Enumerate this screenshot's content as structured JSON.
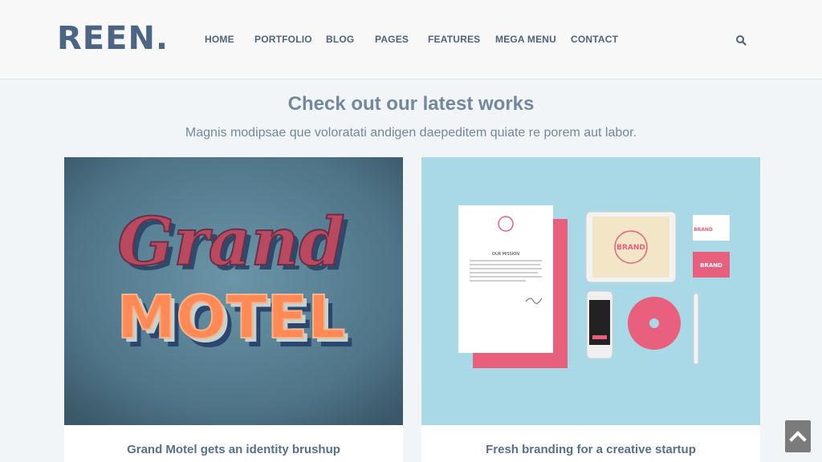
{
  "brand": {
    "logo": "REEN."
  },
  "nav": {
    "items": [
      "HOME",
      "PORTFOLIO",
      "BLOG",
      "PAGES",
      "FEATURES",
      "MEGA MENU",
      "CONTACT"
    ],
    "search_icon": "search-icon"
  },
  "section": {
    "title": "Check out our latest works",
    "subtitle": "Magnis modipsae que voloratati andigen daepeditem quiate re porem aut labor."
  },
  "works": [
    {
      "title": "Grand Motel gets an identity brushup",
      "image_text_1": "Grand",
      "image_text_2": "MOTEL"
    },
    {
      "title": "Fresh branding for a creative startup",
      "image_text_1": "BRAND",
      "image_text_2": "OUR MISSION"
    }
  ],
  "colors": {
    "brand": "#4d6585",
    "nav_text": "#50637a",
    "heading": "#73879e",
    "card_title": "#55708e",
    "motel_bg": "#5f879a",
    "branding_bg": "#a9d8e6",
    "accent_pink": "#e9607e",
    "motel_orange": "#ff8a55"
  },
  "scroll_top_icon": "chevron-up-icon"
}
